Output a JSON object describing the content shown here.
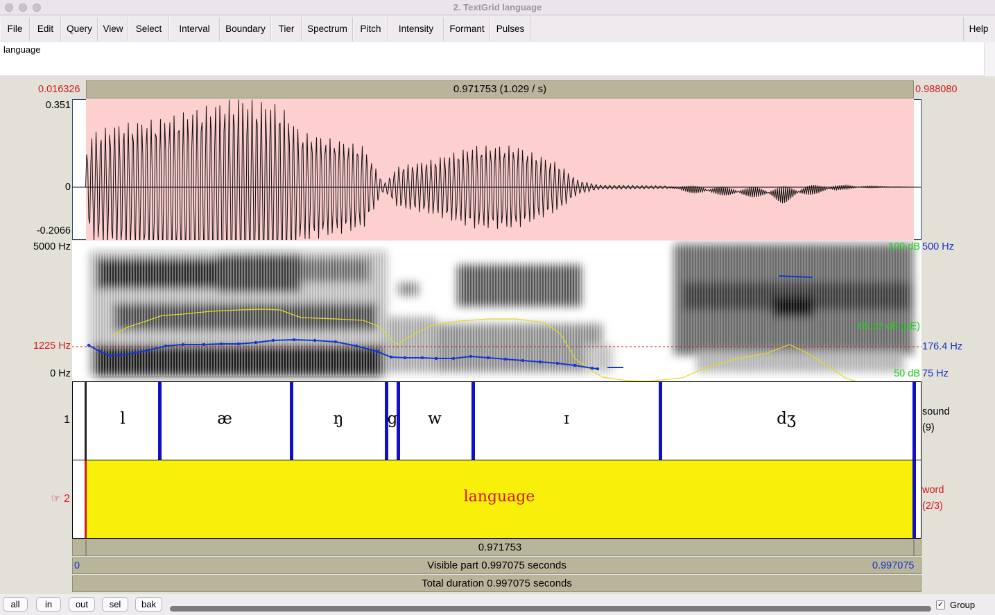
{
  "window": {
    "title": "2. TextGrid language"
  },
  "menu": {
    "items": [
      "File",
      "Edit",
      "Query",
      "View",
      "Select",
      "Interval",
      "Boundary",
      "Tier",
      "Spectrum",
      "Pitch",
      "Intensity",
      "Formant",
      "Pulses"
    ],
    "help": "Help"
  },
  "text_field": {
    "value": "language"
  },
  "time_axis": {
    "left_time": "0.016326",
    "right_time": "0.988080",
    "selection_label": "0.971753 (1.029 / s)",
    "selection_bottom_label": "0.971753",
    "visible_start": "0",
    "visible_end": "0.997075",
    "visible_part": "Visible part 0.997075 seconds",
    "total_duration": "Total duration 0.997075 seconds"
  },
  "waveform": {
    "max": "0.351",
    "zero": "0",
    "min": "-0.2066"
  },
  "spectrogram": {
    "freq_top": "5000 Hz",
    "freq_cursor": "1225 Hz",
    "freq_bottom": "0 Hz",
    "intensity_top": "100 dB",
    "intensity_value": "69.12 dB (μE)",
    "intensity_bottom": "50 dB",
    "pitch_top": "500 Hz",
    "pitch_value": "176.4 Hz",
    "pitch_bottom": "75 Hz",
    "colors": {
      "pitch": "#1438d0",
      "intensity": "#e6d81e",
      "cursor": "#d01a1a"
    }
  },
  "tiers": [
    {
      "number": "1",
      "name": "sound",
      "count": "(9)",
      "intervals": [
        "l",
        "æ",
        "ŋ",
        "g",
        "w",
        "ɪ",
        "dʒ"
      ]
    },
    {
      "number": "☞ 2",
      "name": "word",
      "count": "(2/3)",
      "intervals": [
        "language"
      ]
    }
  ],
  "bottom_buttons": [
    "all",
    "in",
    "out",
    "sel",
    "bak"
  ],
  "group": {
    "label": "Group",
    "checked": "✓"
  },
  "colors": {
    "selection_wave": "#fdcfcf",
    "selection_tier": "#f8f00a",
    "boundary": "#0f10c8",
    "bar": "#b8b59a"
  }
}
